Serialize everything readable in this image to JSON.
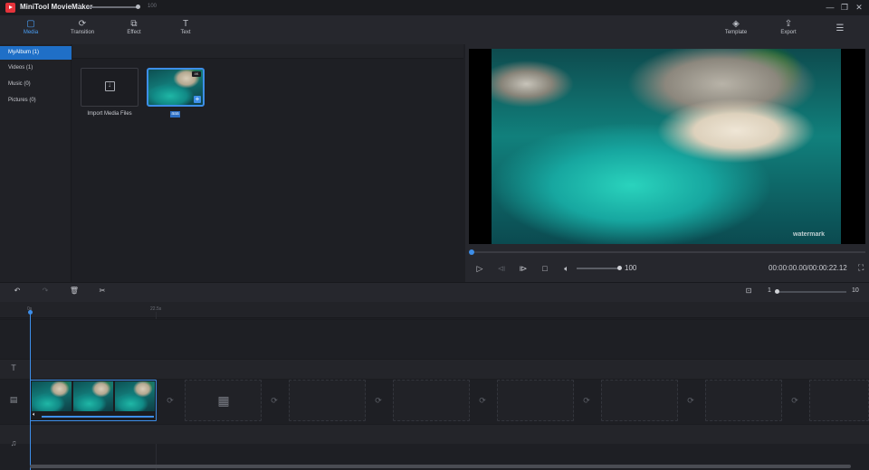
{
  "app": {
    "title": "MiniTool MovieMaker"
  },
  "window_controls": {
    "minimize": "—",
    "restore": "❐",
    "close": "✕"
  },
  "toolbar": {
    "tabs": [
      {
        "label": "Media",
        "icon": "media-icon",
        "active": true
      },
      {
        "label": "Transition",
        "icon": "transition-icon"
      },
      {
        "label": "Effect",
        "icon": "effect-icon"
      },
      {
        "label": "Text",
        "icon": "text-icon"
      }
    ],
    "right": [
      {
        "label": "Template",
        "icon": "template-icon"
      },
      {
        "label": "Export",
        "icon": "export-icon"
      },
      {
        "label": "",
        "icon": "menu-icon"
      }
    ]
  },
  "sidebar": {
    "items": [
      {
        "label": "MyAlbum  (1)",
        "active": true
      },
      {
        "label": "Videos  (1)"
      },
      {
        "label": "Music  (0)"
      },
      {
        "label": "Pictures  (0)"
      }
    ]
  },
  "media": {
    "size_slider": {
      "min_label": "1",
      "max_label": "100",
      "value": 100
    },
    "import_label": "Import Media Files",
    "clip": {
      "name": "aaa",
      "badge": "4K"
    }
  },
  "player": {
    "watermark": "watermark",
    "volume": "100",
    "timecode": "00:00:00.00/00:00:22.12",
    "progress": 0
  },
  "timeline": {
    "zoom": {
      "min": "1",
      "max": "10",
      "value": 1
    },
    "ruler": {
      "start": "0s",
      "end": "22.5s"
    },
    "tracks": [
      "text-track",
      "video-track",
      "music-track"
    ]
  },
  "colors": {
    "accent": "#3d8ee8",
    "selected": "#1f6fc7",
    "logo": "#e5333b"
  }
}
